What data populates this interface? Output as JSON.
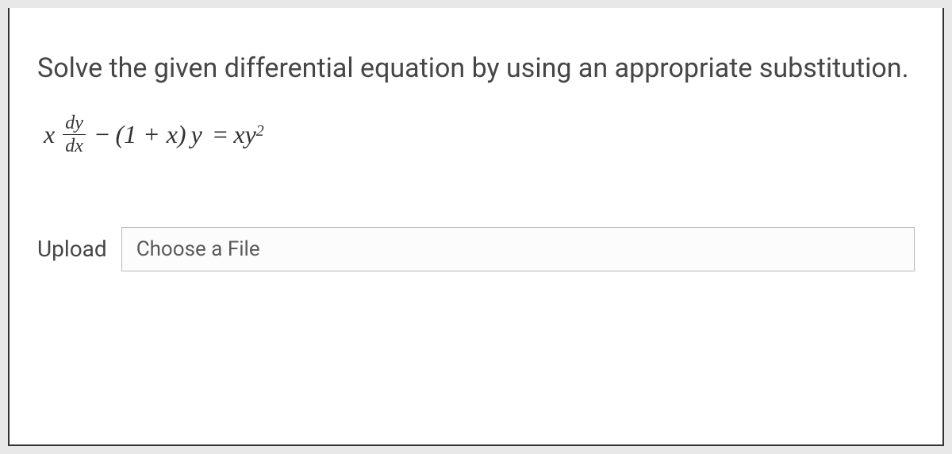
{
  "question": {
    "prompt": "Solve the given differential equation by using an appropriate substitution.",
    "equation": {
      "lhs_coef": "x",
      "fraction_num": "dy",
      "fraction_den": "dx",
      "minus": "−",
      "paren": "(1 + x)",
      "y": "y",
      "equals": "=",
      "rhs": "xy",
      "exponent": "2"
    }
  },
  "upload": {
    "label": "Upload",
    "placeholder": "Choose a File"
  }
}
